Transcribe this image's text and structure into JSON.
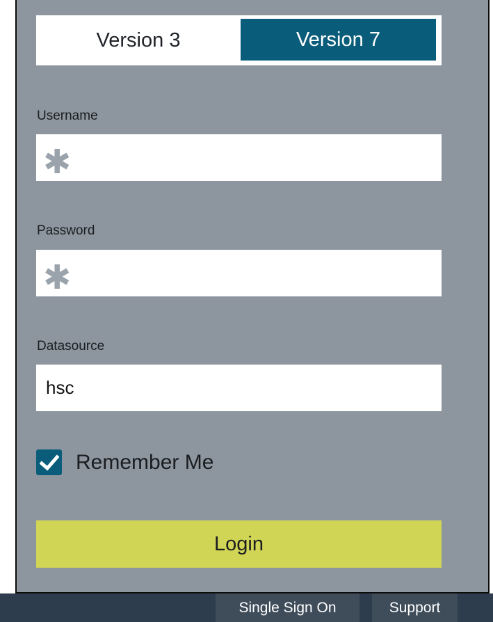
{
  "tabs": [
    {
      "label": "Version 3",
      "active": false
    },
    {
      "label": "Version 7",
      "active": true
    }
  ],
  "form": {
    "username_label": "Username",
    "password_label": "Password",
    "datasource_label": "Datasource",
    "datasource_value": "hsc",
    "required_marker": "✱",
    "remember_label": "Remember Me",
    "remember_checked": true,
    "login_label": "Login"
  },
  "footer": {
    "sso_label": "Single Sign On",
    "support_label": "Support"
  },
  "colors": {
    "panel": "#8d969e",
    "accent": "#0a5d7a",
    "login": "#d1d556",
    "footer": "#2e3d4d"
  }
}
